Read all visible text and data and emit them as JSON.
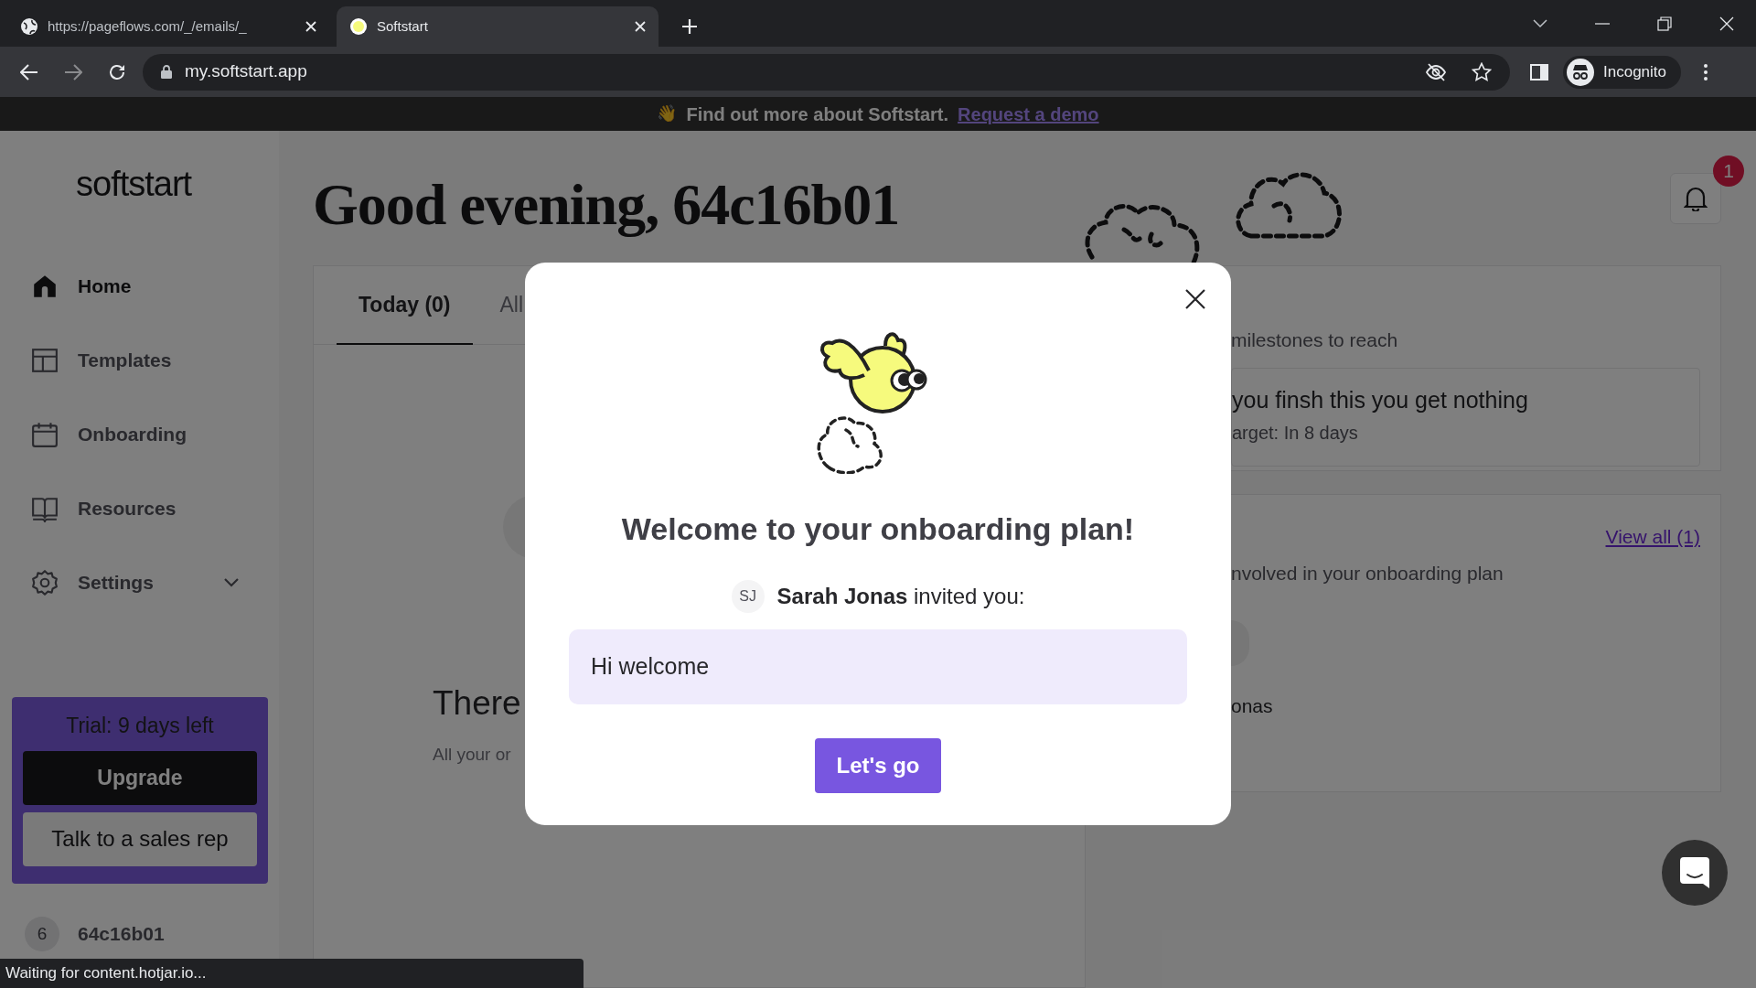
{
  "browser": {
    "tabs": [
      {
        "title": "https://pageflows.com/_/emails/_",
        "selected": false
      },
      {
        "title": "Softstart",
        "selected": true
      }
    ],
    "url": "my.softstart.app",
    "profile": "Incognito"
  },
  "banner": {
    "emoji": "👋",
    "text": "Find out more about Softstart.",
    "link": "Request a demo"
  },
  "sidebar": {
    "logo": "softstart",
    "items": [
      {
        "label": "Home",
        "selected": true,
        "kind": "link"
      },
      {
        "label": "Templates",
        "selected": false,
        "kind": "link"
      },
      {
        "label": "Onboarding",
        "selected": false,
        "kind": "link"
      },
      {
        "label": "Resources",
        "selected": false,
        "kind": "link"
      },
      {
        "label": "Settings",
        "selected": false,
        "kind": "menu"
      }
    ],
    "trial": {
      "text": "Trial: 9 days left",
      "upgrade": "Upgrade",
      "sales": "Talk to a sales rep"
    },
    "user": {
      "avatar": "6",
      "name": "64c16b01"
    }
  },
  "greeting": "Good evening, 64c16b01",
  "notifications": {
    "count": "1"
  },
  "tasks": {
    "tabs": [
      {
        "label": "Today (0)",
        "selected": true
      },
      {
        "label": "All",
        "selected": false
      }
    ],
    "empty_title": "There",
    "empty_text": "All your or"
  },
  "milestones": {
    "subtitle": "milestones to reach",
    "item_title": "you finsh this you get nothing",
    "item_target": "arget: In 8 days"
  },
  "people": {
    "link": "View all (1)",
    "subtitle": "nvolved in your onboarding plan",
    "person": "onas"
  },
  "modal": {
    "title": "Welcome to your onboarding plan!",
    "inviter_initials": "SJ",
    "inviter": "Sarah Jonas",
    "invite_text": "invited you:",
    "message": "Hi welcome",
    "button": "Let's go"
  },
  "status_bar": "Waiting for content.hotjar.io..."
}
